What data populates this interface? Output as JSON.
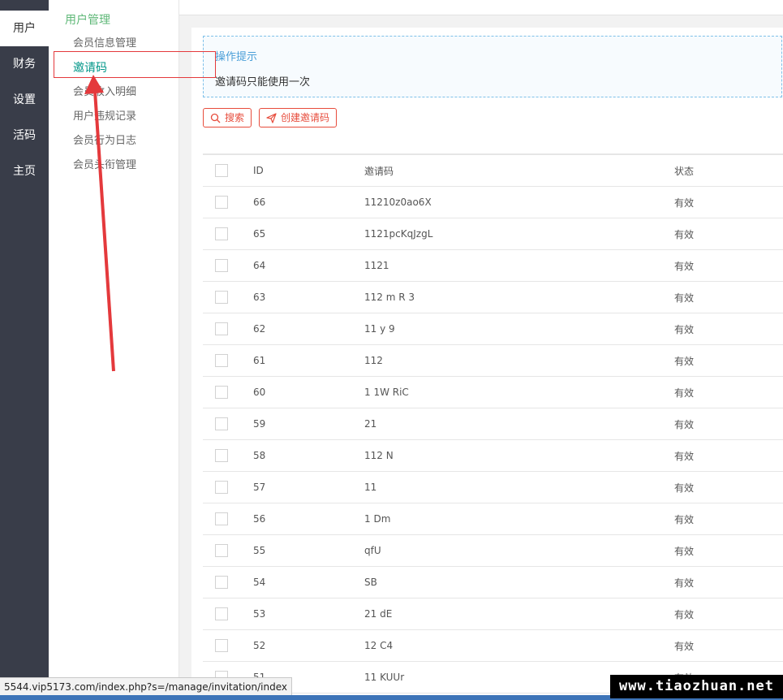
{
  "nav": {
    "items": [
      {
        "label": "用户",
        "active": true
      },
      {
        "label": "财务",
        "active": false
      },
      {
        "label": "设置",
        "active": false
      },
      {
        "label": "活码",
        "active": false
      },
      {
        "label": "主页",
        "active": false
      }
    ]
  },
  "submenu": {
    "title": "用户管理",
    "items": [
      {
        "label": "会员信息管理",
        "active": false
      },
      {
        "label": "邀请码",
        "active": true
      },
      {
        "label": "会员收入明细",
        "active": false
      },
      {
        "label": "用户违规记录",
        "active": false
      },
      {
        "label": "会员行为日志",
        "active": false
      },
      {
        "label": "会员头衔管理",
        "active": false
      }
    ]
  },
  "tips": {
    "title": "操作提示",
    "text": "邀请码只能使用一次"
  },
  "toolbar": {
    "search_label": "搜索",
    "create_label": "创建邀请码"
  },
  "table": {
    "headers": {
      "id": "ID",
      "code": "邀请码",
      "status": "状态"
    },
    "rows": [
      {
        "id": "66",
        "code": "11210z0ao6X",
        "status": "有效"
      },
      {
        "id": "65",
        "code": "1121pcKqJzgL",
        "status": "有效"
      },
      {
        "id": "64",
        "code": "1121",
        "status": "有效"
      },
      {
        "id": "63",
        "code": "112 m R 3",
        "status": "有效"
      },
      {
        "id": "62",
        "code": "11 y 9",
        "status": "有效"
      },
      {
        "id": "61",
        "code": "112",
        "status": "有效"
      },
      {
        "id": "60",
        "code": "1 1W RiC",
        "status": "有效"
      },
      {
        "id": "59",
        "code": "21",
        "status": "有效"
      },
      {
        "id": "58",
        "code": "112 N",
        "status": "有效"
      },
      {
        "id": "57",
        "code": "11",
        "status": "有效"
      },
      {
        "id": "56",
        "code": "1 Dm",
        "status": "有效"
      },
      {
        "id": "55",
        "code": "qfU",
        "status": "有效"
      },
      {
        "id": "54",
        "code": "SB",
        "status": "有效"
      },
      {
        "id": "53",
        "code": "21 dE",
        "status": "有效"
      },
      {
        "id": "52",
        "code": "12 C4",
        "status": "有效"
      },
      {
        "id": "51",
        "code": "11 KUUr",
        "status": "有效"
      }
    ]
  },
  "statusbar": {
    "url": "5544.vip5173.com/index.php?s=/manage/invitation/index"
  },
  "watermark": {
    "text": "www.tiaozhuan.net"
  },
  "colors": {
    "nav_bg": "#393d49",
    "accent_green": "#009688",
    "title_green": "#5fb878",
    "button_red": "#e74c3c",
    "annotation_red": "#e4393c"
  }
}
